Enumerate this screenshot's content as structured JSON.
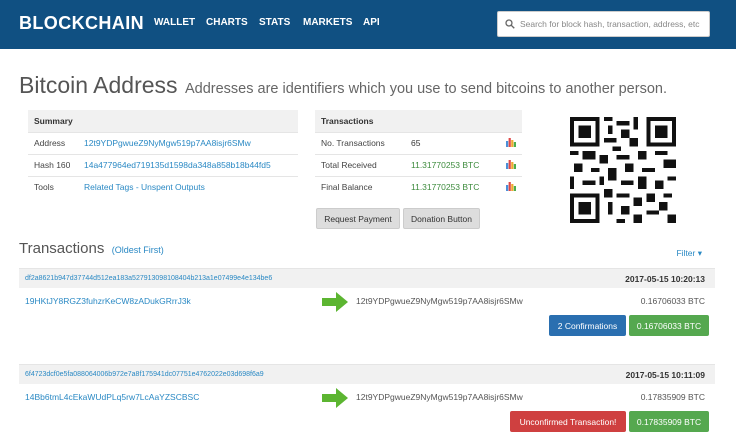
{
  "nav": {
    "brand": "BLOCKCHAIN",
    "links": [
      "WALLET",
      "CHARTS",
      "STATS",
      "MARKETS",
      "API"
    ],
    "search_placeholder": "Search for block hash, transaction, address, etc"
  },
  "heading": {
    "title": "Bitcoin Address",
    "subtitle": "Addresses are identifiers which you use to send bitcoins to another person."
  },
  "summary": {
    "header": "Summary",
    "rows": [
      {
        "label": "Address",
        "value": "12t9YDPgwueZ9NyMgw519p7AA8isjr6SMw"
      },
      {
        "label": "Hash 160",
        "value": "14a477964ed719135d1598da348a858b18b44fd5"
      },
      {
        "label": "Tools",
        "value1": "Related Tags",
        "sep": " - ",
        "value2": "Unspent Outputs"
      }
    ]
  },
  "transactions_summary": {
    "header": "Transactions",
    "rows": [
      {
        "label": "No. Transactions",
        "value": "65"
      },
      {
        "label": "Total Received",
        "value": "11.31770253 BTC"
      },
      {
        "label": "Final Balance",
        "value": "11.31770253 BTC"
      }
    ]
  },
  "buttons": {
    "request_payment": "Request Payment",
    "donation": "Donation Button"
  },
  "tx_section": {
    "title": "Transactions",
    "order": "(Oldest First)",
    "filter": "Filter ▾"
  },
  "txs": [
    {
      "hash": "df2a8621b947d37744d512ea183a527913098108404b213a1e07499e4e134be6",
      "time": "2017-05-15 10:20:13",
      "from": "19HKtJY8RGZ3fuhzrKeCW8zADukGRrrJ3k",
      "to": "12t9YDPgwueZ9NyMgw519p7AA8isjr6SMw",
      "amount": "0.16706033 BTC",
      "status": "2 Confirmations",
      "total": "0.16706033 BTC"
    },
    {
      "hash": "6f4723dcf0e5fa088064006b972e7a8f175941dc07751e4762022e03d698f6a9",
      "time": "2017-05-15 10:11:09",
      "from": "14Bb6tmL4cEkaWUdPLq5rw7LcAaYZSCBSC",
      "to": "12t9YDPgwueZ9NyMgw519p7AA8isjr6SMw",
      "amount": "0.17835909 BTC",
      "status": "Unconfirmed Transaction!",
      "total": "0.17835909 BTC"
    }
  ],
  "icons": {
    "search": "search-icon",
    "chart": "bar-chart-icon",
    "arrow": "arrow-right-icon",
    "qr": "qr-code-icon"
  },
  "colors": {
    "nav_bg": "#105082",
    "link": "#2a89c4",
    "green": "#55a84f",
    "blue": "#2a6fb0",
    "red": "#cf4040"
  }
}
